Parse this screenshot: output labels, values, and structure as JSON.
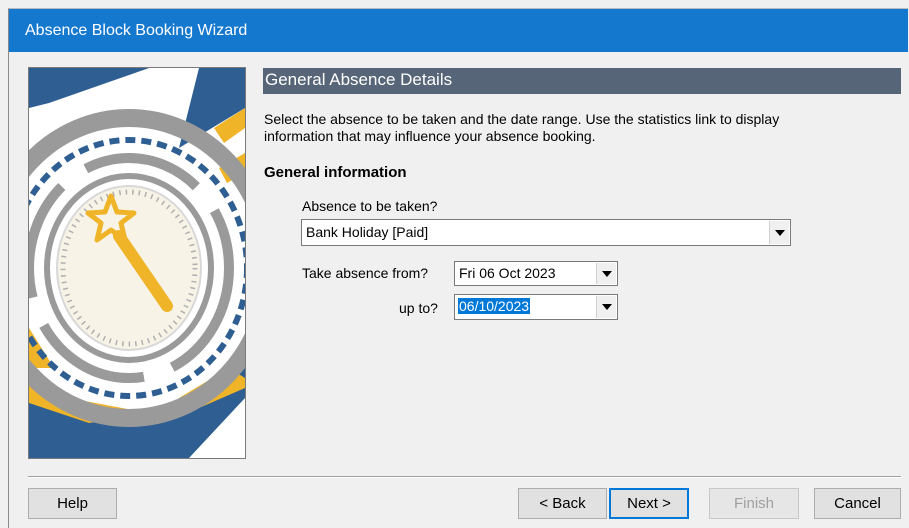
{
  "window": {
    "title": "Absence Block Booking Wizard"
  },
  "section": {
    "title": "General Absence Details"
  },
  "intro": {
    "line1": "Select the absence to be taken and the date range.   Use the statistics link to display",
    "line2": "information that may influence your absence booking."
  },
  "general": {
    "heading": "General information",
    "absence_label": "Absence to be taken?",
    "absence_value": "Bank Holiday [Paid]",
    "from_label": "Take absence from?",
    "from_value": "Fri 06 Oct 2023",
    "upto_label": "up to?",
    "upto_value": "06/10/2023"
  },
  "buttons": {
    "help": "Help",
    "back": "< Back",
    "next": "Next >",
    "finish": "Finish",
    "cancel": "Cancel"
  },
  "colors": {
    "titlebar": "#1578cf",
    "section_bar": "#566577",
    "selection": "#0078d7",
    "art_blue": "#2e5e92",
    "art_gold": "#f0b429",
    "art_gray": "#9a9a9a"
  },
  "icons": {
    "illustration": "wizard-wand-dial-graphic",
    "dropdown": "chevron-down-icon"
  }
}
